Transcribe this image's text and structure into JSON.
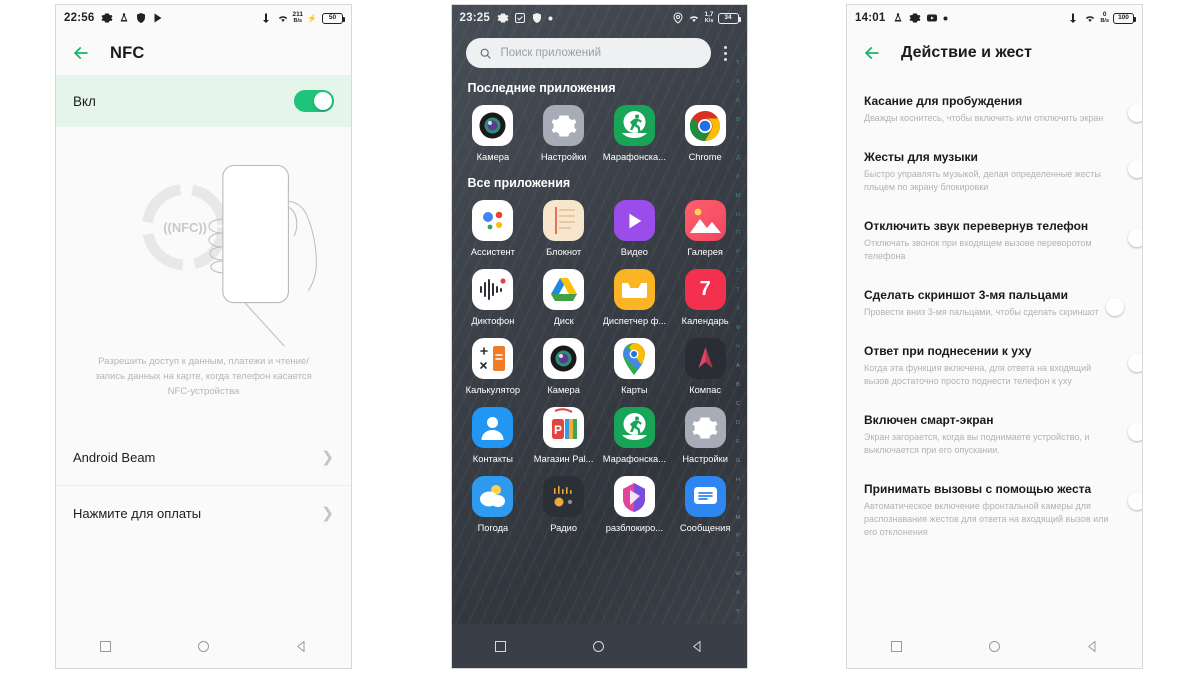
{
  "screens": {
    "nfc": {
      "status": {
        "time": "22:56",
        "battery": "50",
        "net_speed": "211",
        "net_unit": "B/s"
      },
      "title": "NFC",
      "toggle_label": "Вкл",
      "toggle_state": "on",
      "illustration_label": "((NFC))",
      "description": "Разрешить доступ к данным, платежи и чтение/запись данных на карте, когда телефон касается NFC-устройства",
      "rows": [
        {
          "label": "Android Beam"
        },
        {
          "label": "Нажмите для оплаты"
        }
      ]
    },
    "drawer": {
      "status": {
        "time": "23:25",
        "battery": "34",
        "net_speed": "1,7",
        "net_unit": "K/s"
      },
      "search_placeholder": "Поиск приложений",
      "recent_title": "Последние приложения",
      "all_title": "Все приложения",
      "recent_apps": [
        {
          "name": "Камера",
          "icon": "camera-app-icon"
        },
        {
          "name": "Настройки",
          "icon": "settings-app-icon"
        },
        {
          "name": "Марафонска...",
          "icon": "marathon-app-icon"
        },
        {
          "name": "Chrome",
          "icon": "chrome-app-icon"
        }
      ],
      "all_apps": [
        {
          "name": "Ассистент",
          "icon": "assistant-app-icon"
        },
        {
          "name": "Блокнот",
          "icon": "notes-app-icon"
        },
        {
          "name": "Видео",
          "icon": "video-app-icon"
        },
        {
          "name": "Галерея",
          "icon": "gallery-app-icon"
        },
        {
          "name": "Диктофон",
          "icon": "recorder-app-icon"
        },
        {
          "name": "Диск",
          "icon": "drive-app-icon"
        },
        {
          "name": "Диспетчер ф...",
          "icon": "filemanager-app-icon"
        },
        {
          "name": "Календарь",
          "icon": "calendar-app-icon"
        },
        {
          "name": "Калькулятор",
          "icon": "calculator-app-icon"
        },
        {
          "name": "Камера",
          "icon": "camera-app-icon"
        },
        {
          "name": "Карты",
          "icon": "maps-app-icon"
        },
        {
          "name": "Компас",
          "icon": "compass-app-icon"
        },
        {
          "name": "Контакты",
          "icon": "contacts-app-icon"
        },
        {
          "name": "Магазин Pal...",
          "icon": "palmstore-app-icon"
        },
        {
          "name": "Марафонска...",
          "icon": "marathon-app-icon"
        },
        {
          "name": "Настройки",
          "icon": "settings-app-icon"
        },
        {
          "name": "Погода",
          "icon": "weather-app-icon"
        },
        {
          "name": "Радио",
          "icon": "radio-app-icon"
        },
        {
          "name": "разблокиро...",
          "icon": "unlock-app-icon"
        },
        {
          "name": "Сообщения",
          "icon": "messages-app-icon"
        }
      ],
      "calendar_day": "7",
      "index_letters": [
        "¶",
        "А",
        "Б",
        "В",
        "Г",
        "Д",
        "К",
        "М",
        "Н",
        "П",
        "Р",
        "С",
        "Т",
        "У",
        "Ф",
        "Ч",
        "A",
        "B",
        "C",
        "D",
        "F",
        "G",
        "H",
        "I",
        "M",
        "P",
        "S",
        "W",
        "X",
        "Y"
      ]
    },
    "gestures": {
      "status": {
        "time": "14:01",
        "battery": "100",
        "net_speed": "0",
        "net_unit": "B/s"
      },
      "title": "Действие и жест",
      "items": [
        {
          "name": "Касание для пробуждения",
          "sub": "Дважды коснитесь, чтобы включить или отключить экран",
          "state": "off"
        },
        {
          "name": "Жесты для музыки",
          "sub": "Быстро управлять музыкой, делая определенные жесты пльцем по экрану блокировки",
          "state": "off"
        },
        {
          "name": "Отключить звук перевернув телефон",
          "sub": "Отключать звонок при входящем вызове переворотом телефона",
          "state": "off"
        },
        {
          "name": "Сделать скриншот 3-мя пальцами",
          "sub": "Провести вниз 3-мя пальцами, чтобы сделать скриншот",
          "state": "on"
        },
        {
          "name": "Ответ при поднесении к уху",
          "sub": "Когда эта функция включена, для ответа на входящий вызов достаточно просто поднести телефон к уху",
          "state": "off"
        },
        {
          "name": "Включен смарт-экран",
          "sub": "Экран загорается, когда вы поднимаете устройство, и выключается при его опускании.",
          "state": "off"
        },
        {
          "name": "Принимать вызовы с помощью жеста",
          "sub": "Автоматическое включение фронтальной камеры для распознавания жестов для ответа на входящий вызов или его отклонения",
          "state": "off"
        }
      ]
    }
  },
  "colors": {
    "accent_green": "#1dc47a",
    "toggle_off": "#dcdcdc",
    "dark_bg": "#3a3f47"
  }
}
